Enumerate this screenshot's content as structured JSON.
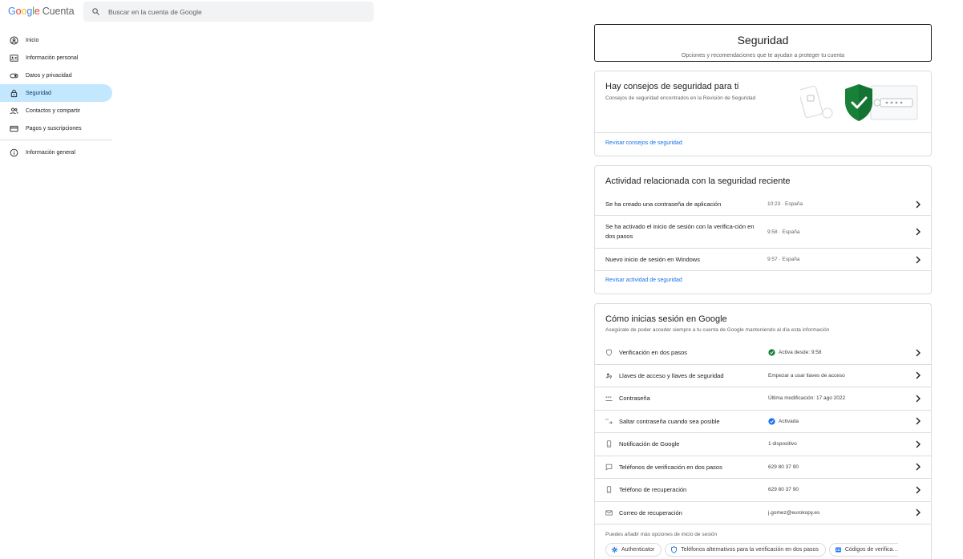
{
  "brand": {
    "google": "Google",
    "product": "Cuenta"
  },
  "search": {
    "placeholder": "Buscar en la cuenta de Google"
  },
  "sidebar": {
    "items": [
      {
        "label": "Inicio",
        "icon": "home-icon"
      },
      {
        "label": "Información personal",
        "icon": "id-card-icon"
      },
      {
        "label": "Datos y privacidad",
        "icon": "toggle-icon"
      },
      {
        "label": "Seguridad",
        "icon": "lock-icon",
        "active": true
      },
      {
        "label": "Contactos y compartir",
        "icon": "people-icon"
      },
      {
        "label": "Pagos y suscripciones",
        "icon": "credit-card-icon"
      }
    ],
    "general": {
      "label": "Información general",
      "icon": "info-icon"
    }
  },
  "header": {
    "title": "Seguridad",
    "subtitle": "Opciones y recomendaciones que te ayudan a proteger tu cuenta"
  },
  "tips": {
    "title": "Hay consejos de seguridad para ti",
    "subtitle": "Consejos de seguridad encontrados en la Revisión de Seguridad",
    "link": "Revisar consejos de seguridad"
  },
  "activity": {
    "title": "Actividad relacionada con la seguridad reciente",
    "rows": [
      {
        "label": "Se ha creado una contraseña de aplicación",
        "value": "10:23 · España"
      },
      {
        "label": "Se ha activado el inicio de sesión con la verifica-ción en dos pasos",
        "value": "9:58 · España"
      },
      {
        "label": "Nuevo inicio de sesión en Windows",
        "value": "9:57 · España"
      }
    ],
    "link": "Revisar actividad de seguridad"
  },
  "signin": {
    "title": "Cómo inicias sesión en Google",
    "subtitle": "Asegúrate de poder acceder siempre a tu cuenta de Google manteniendo al día esta información",
    "rows": [
      {
        "label": "Verificación en dos pasos",
        "value": "Activa desde: 9:58",
        "icon": "shield-icon",
        "badge": "green-check-icon"
      },
      {
        "label": "Llaves de acceso y llaves de seguridad",
        "value": "Empezar a usar llaves de acceso",
        "icon": "passkey-icon"
      },
      {
        "label": "Contraseña",
        "value": "Última modificación: 17 ago 2022",
        "icon": "password-icon"
      },
      {
        "label": "Saltar contraseña cuando sea posible",
        "value": "Activada",
        "icon": "skip-password-icon",
        "badge": "blue-check-icon"
      },
      {
        "label": "Notificación de Google",
        "value": "1 dispositivo",
        "icon": "phone-icon"
      },
      {
        "label": "Teléfonos de verificación en dos pasos",
        "value": "629 80 37 90",
        "icon": "message-icon"
      },
      {
        "label": "Teléfono de recuperación",
        "value": "629 80 37 90",
        "icon": "phone-icon"
      },
      {
        "label": "Correo de recuperación",
        "value": "j.gomez@eurokopy.es",
        "icon": "mail-icon"
      }
    ],
    "more": "Puedes añadir más opciones de inicio de sesión",
    "chips": [
      {
        "label": "Authenticator",
        "icon": "authenticator-icon"
      },
      {
        "label": "Teléfonos alternativos para la verificación en dos pasos",
        "icon": "shield-icon"
      },
      {
        "label": "Códigos de verifica…",
        "icon": "backup-codes-icon"
      }
    ]
  },
  "colors": {
    "accent": "#1a73e8",
    "active_nav": "#c2e7ff",
    "shield_green": "#188038"
  }
}
